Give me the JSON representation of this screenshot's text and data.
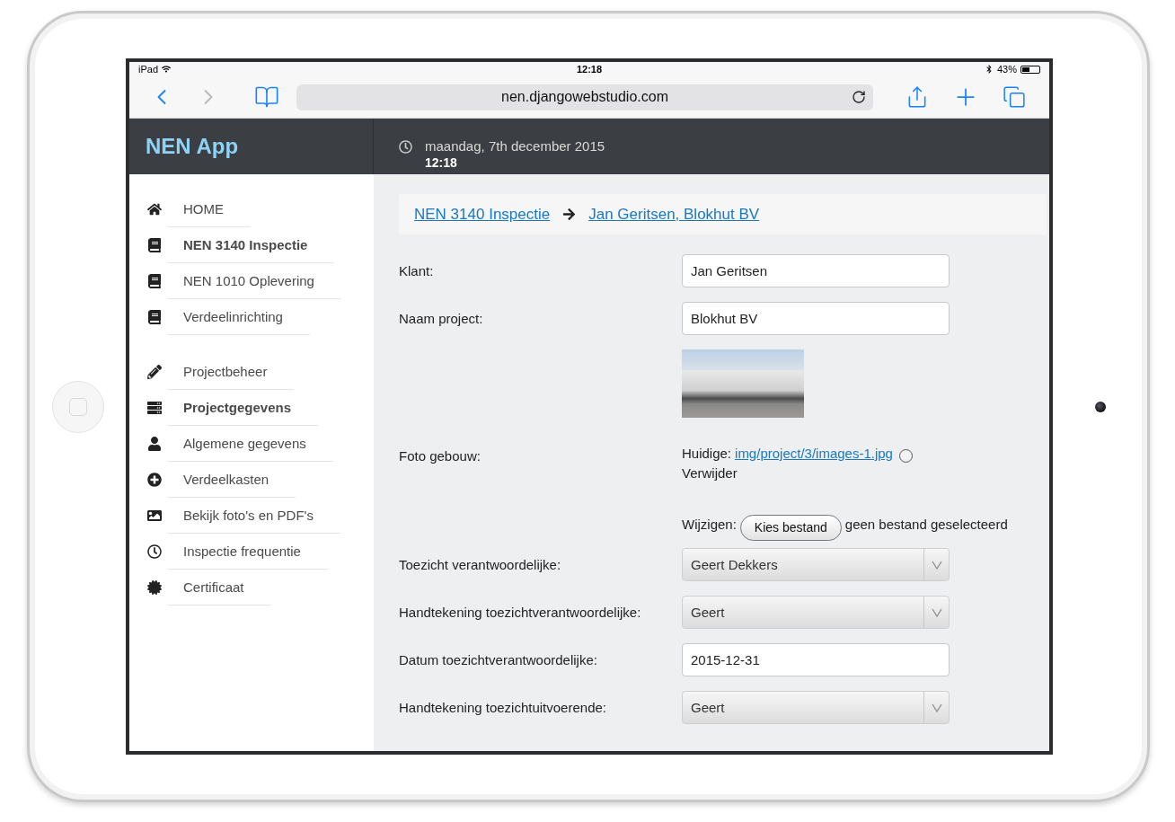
{
  "status_bar": {
    "device": "iPad",
    "time": "12:18",
    "battery": "43%"
  },
  "browser": {
    "back": {
      "disabled": false
    },
    "forward": {
      "disabled": true
    },
    "url": "nen.djangowebstudio.com"
  },
  "header": {
    "app_title": "NEN App",
    "date": "maandag, 7th december 2015",
    "time": "12:18"
  },
  "sidebar": {
    "groups": [
      {
        "items": [
          {
            "label": "HOME",
            "selected": false
          },
          {
            "label": "NEN 3140 Inspectie",
            "selected": true
          },
          {
            "label": "NEN 1010 Oplevering",
            "selected": false
          },
          {
            "label": "Verdeelinrichting",
            "selected": false
          }
        ]
      },
      {
        "items": [
          {
            "label": "Projectbeheer",
            "selected": false
          },
          {
            "label": "Projectgegevens",
            "selected": true
          },
          {
            "label": "Algemene gegevens",
            "selected": false
          },
          {
            "label": "Verdeelkasten",
            "selected": false
          },
          {
            "label": "Bekijk foto's en PDF's",
            "selected": false
          },
          {
            "label": "Inspectie frequentie",
            "selected": false
          },
          {
            "label": "Certificaat",
            "selected": false
          }
        ]
      }
    ]
  },
  "breadcrumb": [
    "NEN 3140 Inspectie",
    "Jan Geritsen, Blokhut BV"
  ],
  "form": {
    "fields": [
      {
        "kind": "text",
        "label": "Klant:",
        "value": "Jan Geritsen"
      },
      {
        "kind": "text",
        "label": "Naam project:",
        "value": "Blokhut BV"
      },
      {
        "kind": "photo",
        "label": "Foto gebouw:",
        "current_label": "Huidige:",
        "current_link": "img/project/3/images-1.jpg",
        "remove_checked": false,
        "remove_label": "Verwijder",
        "change_label": "Wijzigen:",
        "button": "Kies bestand",
        "file_status": "geen bestand geselecteerd"
      },
      {
        "kind": "select",
        "label": "Toezicht verantwoordelijke:",
        "value": "Geert Dekkers"
      },
      {
        "kind": "select",
        "label": "Handtekening toezichtverantwoordelijke:",
        "value": "Geert"
      },
      {
        "kind": "text",
        "label": "Datum toezichtverantwoordelijke:",
        "value": "2015-12-31"
      },
      {
        "kind": "select",
        "label": "Handtekening toezichtuitvoerende:",
        "value": "Geert"
      }
    ]
  }
}
